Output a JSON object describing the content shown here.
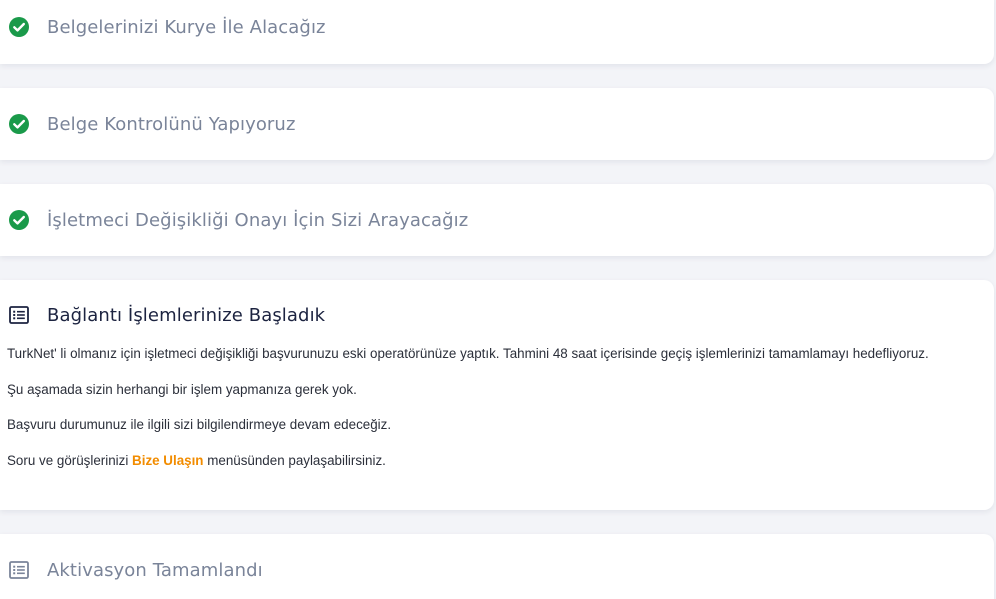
{
  "steps": [
    {
      "title": "Belgelerinizi Kurye İle Alacağız",
      "status": "completed",
      "icon": "check-circle-icon"
    },
    {
      "title": "Belge Kontrolünü Yapıyoruz",
      "status": "completed",
      "icon": "check-circle-icon"
    },
    {
      "title": "İşletmeci Değişikliği Onayı İçin Sizi Arayacağız",
      "status": "completed",
      "icon": "check-circle-icon"
    },
    {
      "title": "Bağlantı İşlemlerinize Başladık",
      "status": "active",
      "icon": "list-icon",
      "paragraphs": [
        "TurkNet' li olmanız için işletmeci değişikliği başvurunuzu eski operatörünüze yaptık. Tahmini 48 saat içerisinde geçiş işlemlerinizi tamamlamayı hedefliyoruz.",
        "Şu aşamada sizin herhangi bir işlem yapmanıza gerek yok.",
        "Başvuru durumunuz ile ilgili sizi bilgilendirmeye devam edeceğiz."
      ],
      "contact_prefix": "Soru ve görüşlerinizi ",
      "contact_link": "Bize Ulaşın",
      "contact_suffix": " menüsünden paylaşabilirsiniz."
    },
    {
      "title": "Aktivasyon Tamamlandı",
      "status": "pending",
      "icon": "list-icon"
    }
  ],
  "colors": {
    "success": "#1a9a4a",
    "accent": "#f28c00",
    "title_muted": "#7a8499",
    "title_active": "#1c2340"
  }
}
